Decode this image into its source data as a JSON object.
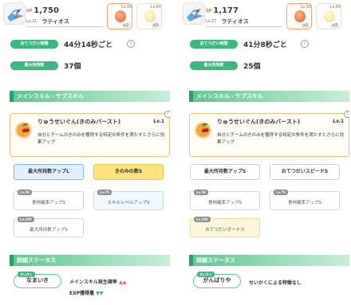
{
  "panels": [
    {
      "header": {
        "sp_label": "SP",
        "sp_value": "1,750",
        "level": "Lv.21",
        "name": "ラティオス",
        "candy1_level": "Lv.30",
        "candy1_count": "x2",
        "candy2_level": "Lv.60",
        "candy2_count": "x3"
      },
      "help_label": "おてつだい時間",
      "help_value": "44分14秒ごと",
      "carry_label": "最大所持数",
      "carry_value": "37個",
      "section_skills": "メインスキル・サブスキル",
      "skill": {
        "name": "りゅうせいぐん(きのみバースト)",
        "level": "Lv.1",
        "description": "自分とチームのきのみを獲得する特定の条件を満たすとさらに効果アップ"
      },
      "subskills": [
        {
          "label": "最大所持数アップL",
          "style": "blue"
        },
        {
          "label": "きのみの数S",
          "style": "gold"
        },
        {
          "badge": "Lv.50",
          "label": "食材確率アップS",
          "style": "lock"
        },
        {
          "badge": "Lv.75",
          "label": "スキルレベルアップS",
          "style": "lock-paleblue"
        },
        {
          "badge": "Lv.100",
          "label": "最大所持数アップS",
          "style": "lock"
        }
      ],
      "section_detail": "詳細ステータス",
      "nature_tag": "せいかく",
      "nature": "なまいき",
      "effects": [
        {
          "label": "メインスキル発生確率",
          "arrows": "▲▲",
          "dir": "up"
        },
        {
          "label": "EXP獲得量",
          "arrows": "▼▼",
          "dir": "down"
        }
      ]
    },
    {
      "header": {
        "sp_label": "SP",
        "sp_value": "1,177",
        "level": "Lv.27",
        "name": "ラティオス",
        "candy1_level": "Lv.30",
        "candy1_count": "x2",
        "candy2_level": "Lv.60",
        "candy2_count": "x3"
      },
      "help_label": "おてつだい時間",
      "help_value": "41分8秒ごと",
      "carry_label": "最大所持数",
      "carry_value": "25個",
      "section_skills": "メインスキル・サブスキル",
      "skill": {
        "name": "りゅうせいぐん(きのみバースト)",
        "level": "Lv.1",
        "description": "自分とチームのきのみを獲得する特定の条件を満たすとさらに効果アップ"
      },
      "subskills": [
        {
          "label": "最大所持数アップS",
          "style": "plain"
        },
        {
          "label": "おてつだいスピードS",
          "style": "plain"
        },
        {
          "badge": "Lv.50",
          "label": "食材確率アップS",
          "style": "lock"
        },
        {
          "badge": "Lv.75",
          "label": "食材確率アップS",
          "style": "lock"
        },
        {
          "badge": "Lv.100",
          "label": "おてつだいボーナス",
          "style": "lock-paleyellow"
        }
      ],
      "section_detail": "詳細ステータス",
      "nature_tag": "せいかく",
      "nature": "がんばりや",
      "effects": [
        {
          "label": "せいかくによる特徴なし",
          "arrows": "",
          "dir": "none"
        }
      ]
    }
  ],
  "colors": {
    "accent_green": "#37ba7e",
    "skill_border": "#f1c27b",
    "up_arrow": "#e55b4b",
    "down_arrow": "#3d8de0"
  },
  "icons": {
    "pokemon": "latios-icon",
    "candy1": "candy-icon",
    "candy2": "egg-candy-icon",
    "skill": "berry-burst-icon",
    "info": "info-icon"
  }
}
